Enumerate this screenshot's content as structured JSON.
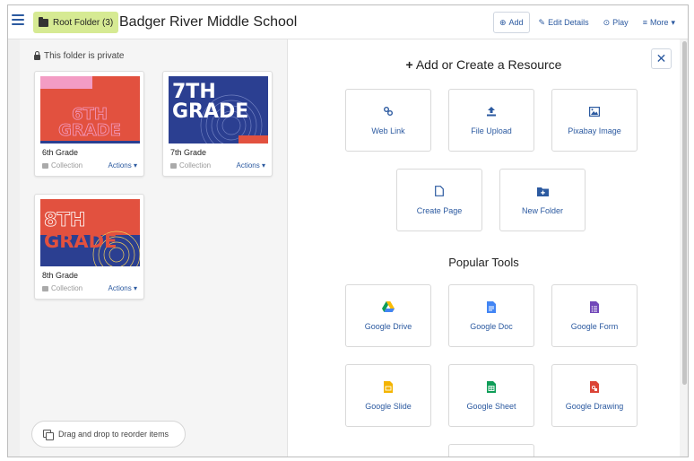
{
  "topbar": {
    "root_folder_label": "Root Folder (3)",
    "title": "Badger River Middle School",
    "add_label": "Add",
    "edit_label": "Edit Details",
    "play_label": "Play",
    "more_label": "More"
  },
  "left": {
    "private_label": "This folder is private",
    "cards": [
      {
        "title": "6th Grade",
        "type": "Collection",
        "actions": "Actions",
        "thumb_text": "6TH GRADE"
      },
      {
        "title": "7th Grade",
        "type": "Collection",
        "actions": "Actions",
        "thumb_text": "7TH GRADE"
      },
      {
        "title": "8th Grade",
        "type": "Collection",
        "actions": "Actions",
        "thumb_text": "8TH GRADE"
      }
    ],
    "drag_hint": "Drag and drop to reorder items"
  },
  "right": {
    "heading": "Add or Create a Resource",
    "resources": [
      {
        "label": "Web Link",
        "icon": "link-icon"
      },
      {
        "label": "File Upload",
        "icon": "upload-icon"
      },
      {
        "label": "Pixabay Image",
        "icon": "image-icon"
      },
      {
        "label": "Create Page",
        "icon": "page-icon"
      },
      {
        "label": "New Folder",
        "icon": "folder-plus-icon"
      }
    ],
    "tools_heading": "Popular Tools",
    "tools": [
      {
        "label": "Google Drive",
        "icon": "google-drive-icon"
      },
      {
        "label": "Google Doc",
        "icon": "google-doc-icon"
      },
      {
        "label": "Google Form",
        "icon": "google-form-icon"
      },
      {
        "label": "Google Slide",
        "icon": "google-slide-icon"
      },
      {
        "label": "Google Sheet",
        "icon": "google-sheet-icon"
      },
      {
        "label": "Google Drawing",
        "icon": "google-drawing-icon"
      }
    ]
  },
  "colors": {
    "accent": "#2c5aa0",
    "root_button": "#d6ea93",
    "card_red": "#e2513f",
    "card_blue": "#2b3f91",
    "card_pink": "#f39cc4"
  }
}
